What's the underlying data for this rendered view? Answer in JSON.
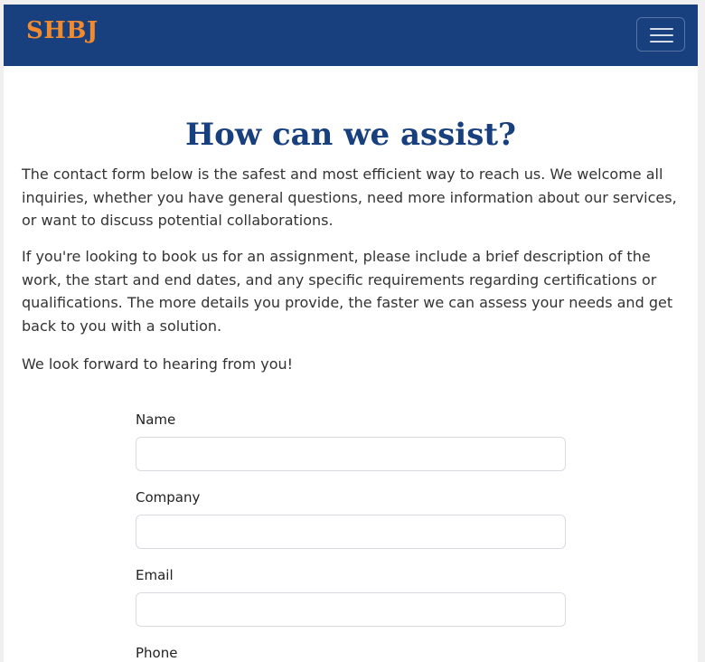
{
  "header": {
    "brand": "SHBJ",
    "menu_icon": "hamburger-menu-icon",
    "bg_color": "#183f7e",
    "brand_color": "#f28a2e"
  },
  "main": {
    "heading": "How can we assist?",
    "paragraphs": [
      "The contact form below is the safest and most efficient way to reach us. We welcome all inquiries, whether you have general questions, need more information about our services, or want to discuss potential collaborations.",
      "If you're looking to book us for an assignment, please include a brief description of the work, the start and end dates, and any specific requirements regarding certifications or qualifications. The more details you provide, the faster we can assess your needs and get back to you with a solution.",
      "We look forward to hearing from you!"
    ]
  },
  "form": {
    "name_label": "Name",
    "name_value": "",
    "company_label": "Company",
    "company_value": "",
    "email_label": "Email",
    "email_value": "",
    "phone_label": "Phone"
  }
}
